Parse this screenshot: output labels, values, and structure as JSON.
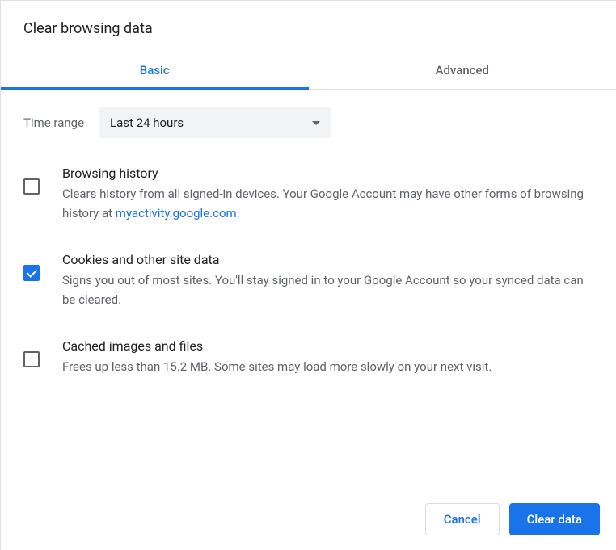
{
  "title": "Clear browsing data",
  "tabs": {
    "basic": "Basic",
    "advanced": "Advanced"
  },
  "time_range": {
    "label": "Time range",
    "value": "Last 24 hours"
  },
  "options": [
    {
      "title": "Browsing history",
      "desc_before": "Clears history from all signed-in devices. Your Google Account may have other forms of browsing history at ",
      "link_text": "myactivity.google.com",
      "desc_after": ".",
      "checked": false
    },
    {
      "title": "Cookies and other site data",
      "desc_before": "Signs you out of most sites. You'll stay signed in to your Google Account so your synced data can be cleared.",
      "link_text": "",
      "desc_after": "",
      "checked": true
    },
    {
      "title": "Cached images and files",
      "desc_before": "Frees up less than 15.2 MB. Some sites may load more slowly on your next visit.",
      "link_text": "",
      "desc_after": "",
      "checked": false
    }
  ],
  "buttons": {
    "cancel": "Cancel",
    "confirm": "Clear data"
  }
}
